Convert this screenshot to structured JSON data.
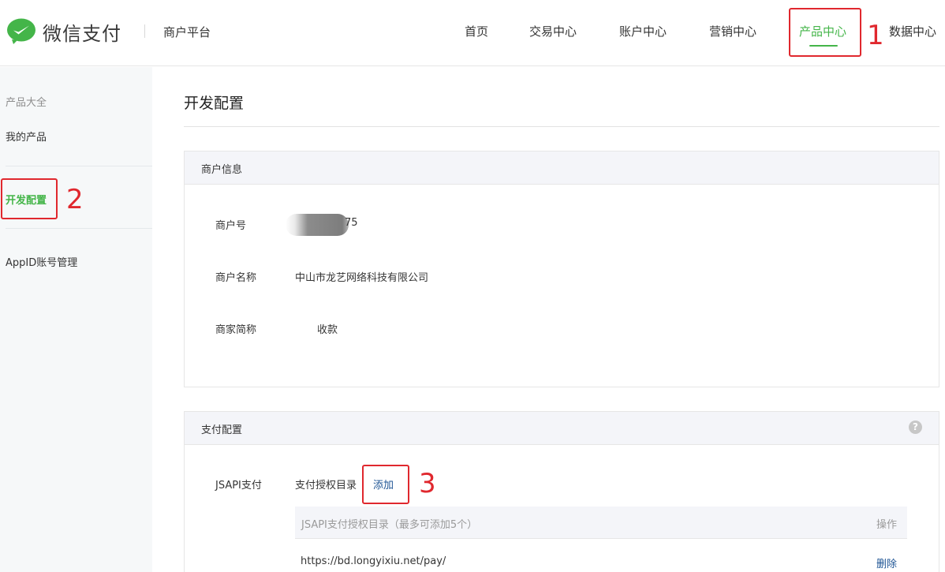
{
  "header": {
    "brand": "微信支付",
    "platform": "商户平台",
    "nav": [
      {
        "label": "首页"
      },
      {
        "label": "交易中心"
      },
      {
        "label": "账户中心"
      },
      {
        "label": "营销中心"
      },
      {
        "label": "产品中心",
        "active": true
      },
      {
        "label": "数据中心"
      }
    ]
  },
  "sidebar": {
    "title": "产品大全",
    "items": [
      {
        "label": "我的产品"
      },
      {
        "label": "开发配置",
        "active": true
      },
      {
        "label": "AppID账号管理"
      }
    ]
  },
  "main": {
    "title": "开发配置",
    "merchant_panel": {
      "heading": "商户信息",
      "fields": [
        {
          "label": "商户号",
          "value": "75"
        },
        {
          "label": "商户名称",
          "value": "中山市龙艺网络科技有限公司"
        },
        {
          "label": "商家简称",
          "value": "收款"
        }
      ]
    },
    "payment_panel": {
      "heading": "支付配置",
      "help": "?",
      "jsapi_label": "JSAPI支付",
      "dir_label": "支付授权目录",
      "add_label": "添加",
      "table": {
        "col_dir": "JSAPI支付授权目录（最多可添加5个）",
        "col_op": "操作",
        "rows": [
          {
            "url": "https://bd.longyixiu.net/pay/",
            "action": "删除"
          }
        ]
      }
    }
  },
  "annotations": [
    "1",
    "2",
    "3"
  ],
  "colors": {
    "accent": "#44b549",
    "link": "#1e5494",
    "annotation": "#e0282e"
  }
}
